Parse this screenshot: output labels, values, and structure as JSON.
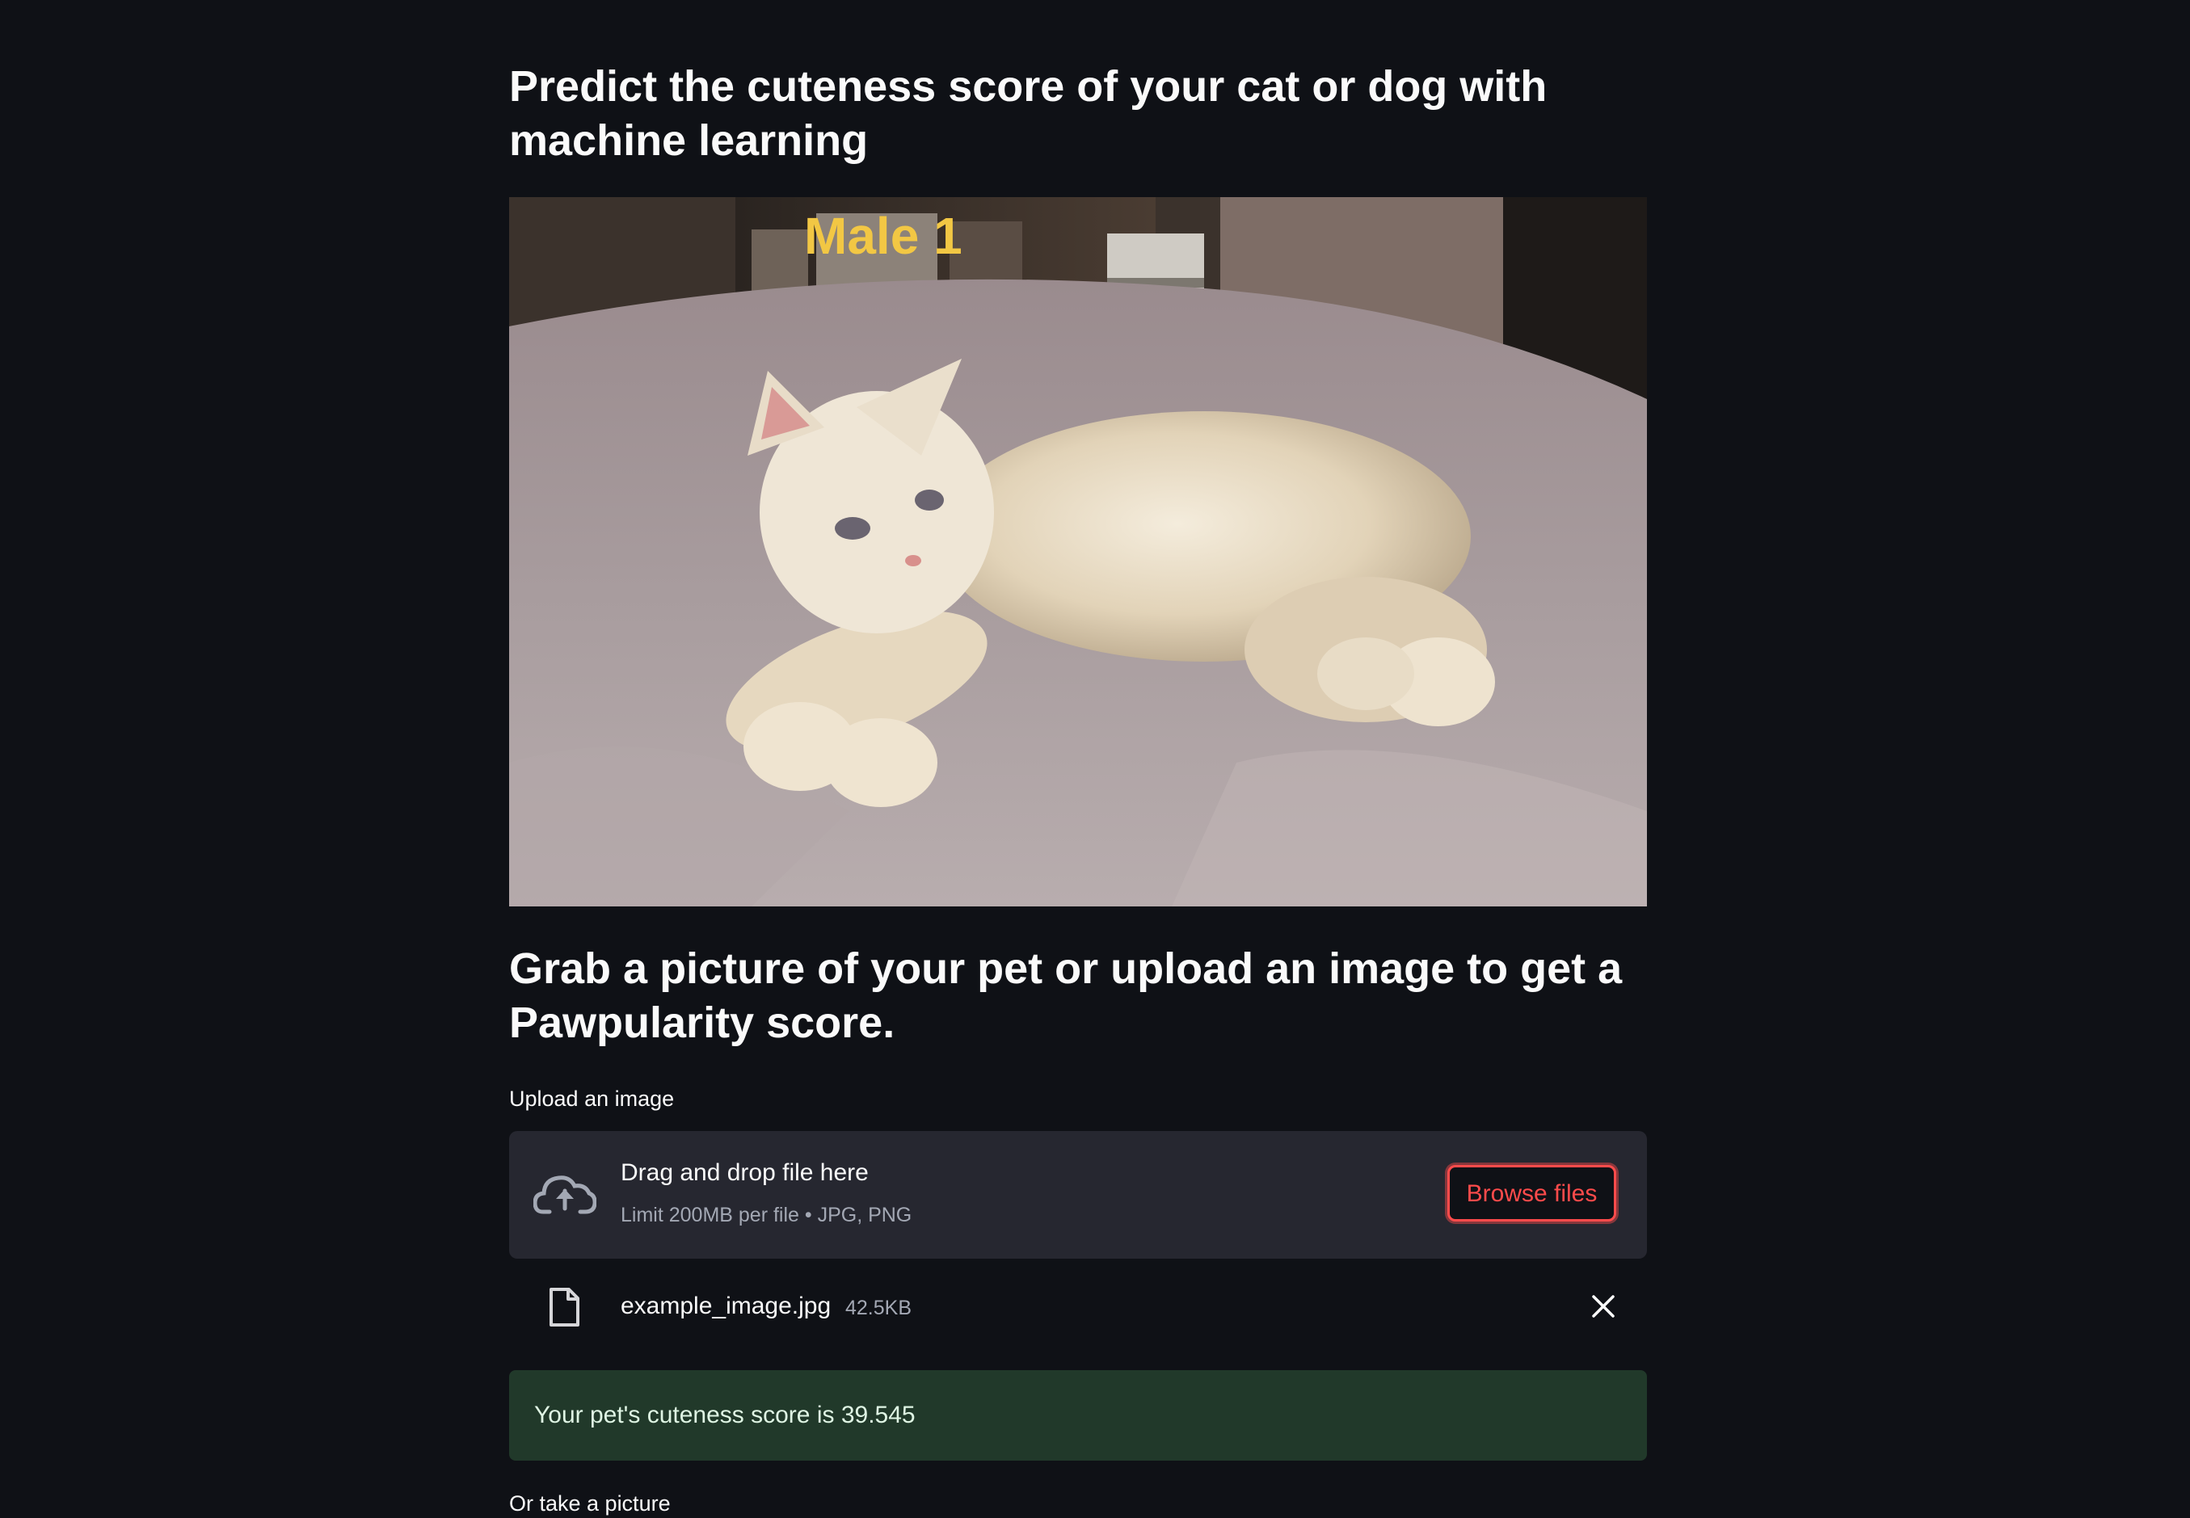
{
  "header": {
    "title": "Predict the cuteness score of your cat or dog with machine learning"
  },
  "hero_image": {
    "caption_overlay": "Male 1",
    "overlay_color": "#f2c744"
  },
  "section": {
    "heading": "Grab a picture of your pet or upload an image to get a Pawpularity score."
  },
  "uploader": {
    "label": "Upload an image",
    "drop_title": "Drag and drop file here",
    "drop_limit": "Limit 200MB per file • JPG, PNG",
    "browse_label": "Browse files",
    "icon": "cloud-upload-icon"
  },
  "uploaded_file": {
    "name": "example_image.jpg",
    "size": "42.5KB",
    "icon": "file-icon",
    "remove_icon": "close-icon"
  },
  "result": {
    "message": "Your pet's cuteness score is 39.545"
  },
  "camera": {
    "label": "Or take a picture"
  },
  "colors": {
    "background": "#0f1116",
    "accent": "#ff4b4b",
    "success_background": "#21392a",
    "dropzone": "#262730"
  }
}
